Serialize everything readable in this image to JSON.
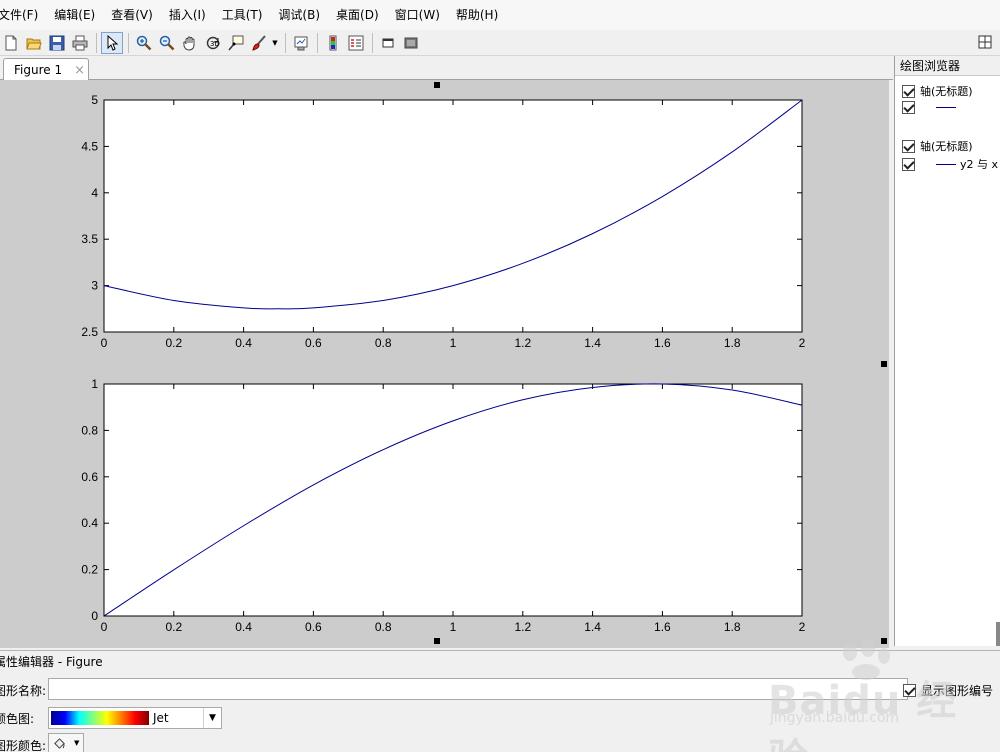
{
  "menu": [
    "文件(F)",
    "编辑(E)",
    "查看(V)",
    "插入(I)",
    "工具(T)",
    "调试(B)",
    "桌面(D)",
    "窗口(W)",
    "帮助(H)"
  ],
  "tab": {
    "label": "Figure 1",
    "close": "×"
  },
  "browser": {
    "title": "绘图浏览器",
    "items": [
      {
        "label": "轴(无标题)",
        "kind": "axes"
      },
      {
        "label": "",
        "kind": "line"
      },
      {
        "label": "轴(无标题)",
        "kind": "axes"
      },
      {
        "label": "y2 与 x",
        "kind": "line"
      }
    ]
  },
  "property_editor": {
    "title": "属性编辑器 - Figure",
    "name_label": "图形名称:",
    "name_value": "",
    "colormap_label": "颜色图:",
    "colormap_value": "Jet",
    "color_label": "图形颜色:",
    "show_number_label": "显示图形编号"
  },
  "watermark": {
    "text": "Baidu 经验",
    "url": "jingyan.baidu.com"
  },
  "colors": {
    "line": "#00008b",
    "canvas": "#cccccc"
  },
  "chart_data": [
    {
      "type": "line",
      "title": "",
      "xlabel": "",
      "ylabel": "",
      "xlim": [
        0,
        2
      ],
      "ylim": [
        2.5,
        5
      ],
      "xticks": [
        "0",
        "0.2",
        "0.4",
        "0.6",
        "0.8",
        "1",
        "1.2",
        "1.4",
        "1.6",
        "1.8",
        "2"
      ],
      "yticks": [
        "2.5",
        "3",
        "3.5",
        "4",
        "4.5",
        "5"
      ],
      "series": [
        {
          "x": [
            0,
            0.2,
            0.4,
            0.5,
            0.6,
            0.8,
            1.0,
            1.2,
            1.4,
            1.6,
            1.8,
            2.0
          ],
          "values": [
            3.0,
            2.84,
            2.76,
            2.75,
            2.76,
            2.84,
            3.0,
            3.24,
            3.56,
            3.96,
            4.44,
            5.0
          ]
        }
      ]
    },
    {
      "type": "line",
      "title": "",
      "xlabel": "",
      "ylabel": "",
      "xlim": [
        0,
        2
      ],
      "ylim": [
        0,
        1
      ],
      "xticks": [
        "0",
        "0.2",
        "0.4",
        "0.6",
        "0.8",
        "1",
        "1.2",
        "1.4",
        "1.6",
        "1.8",
        "2"
      ],
      "yticks": [
        "0",
        "0.2",
        "0.4",
        "0.6",
        "0.8",
        "1"
      ],
      "series": [
        {
          "name": "y2 与 x",
          "x": [
            0,
            0.2,
            0.4,
            0.6,
            0.8,
            1.0,
            1.2,
            1.4,
            1.6,
            1.8,
            2.0
          ],
          "values": [
            0,
            0.199,
            0.389,
            0.565,
            0.717,
            0.841,
            0.932,
            0.985,
            1.0,
            0.974,
            0.909
          ]
        }
      ]
    }
  ]
}
